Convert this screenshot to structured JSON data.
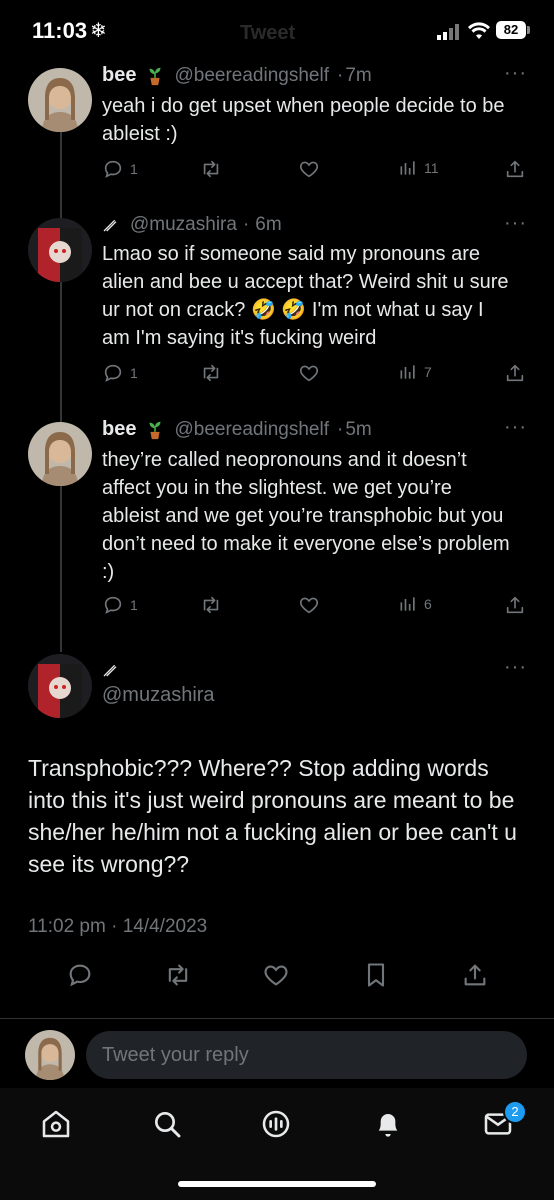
{
  "status_bar": {
    "time": "11:03",
    "battery": "82"
  },
  "header_ghost": "Tweet",
  "tweets": [
    {
      "name": "bee",
      "handle": "@beereadingshelf",
      "time": "7m",
      "text": "yeah i do get upset when people decide to be ableist :)",
      "replies": "1",
      "views": "11"
    },
    {
      "name": "",
      "handle": "@muzashira",
      "time": "6m",
      "text": "Lmao so if someone said my pronouns are alien and bee u accept that? Weird shit u sure ur not on crack? 🤣 🤣 I'm not what u say I am I'm saying it's fucking weird",
      "replies": "1",
      "views": "7"
    },
    {
      "name": "bee",
      "handle": "@beereadingshelf",
      "time": "5m",
      "text": "they’re called neopronouns and it doesn’t affect you in the slightest. we get you’re ableist and we get you’re transphobic but you don’t need to make it everyone else’s problem :)",
      "replies": "1",
      "views": "6"
    }
  ],
  "main_tweet": {
    "handle": "@muzashira",
    "text": "Transphobic??? Where?? Stop adding words into this it's just weird pronouns are meant to be she/her he/him not a fucking alien or bee can't u see its wrong??",
    "timestamp": "11:02 pm · 14/4/2023"
  },
  "reply_box": {
    "placeholder": "Tweet your reply"
  },
  "nav": {
    "messages_badge": "2"
  },
  "icons": [
    "snowflake-icon",
    "signal-icon",
    "wifi-icon",
    "battery-icon",
    "reply-icon",
    "retweet-icon",
    "like-icon",
    "views-icon",
    "share-icon",
    "bookmark-icon",
    "home-icon",
    "search-icon",
    "spaces-icon",
    "notifications-icon",
    "messages-icon",
    "plant-emoji-icon",
    "pen-icon",
    "more-icon"
  ]
}
